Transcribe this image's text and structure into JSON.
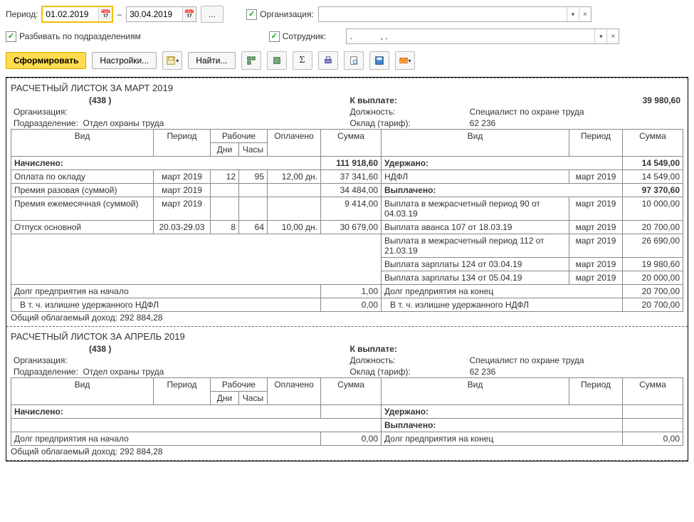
{
  "toolbar": {
    "period_label": "Период:",
    "date_from": "01.02.2019",
    "date_to": "30.04.2019",
    "dash": "–",
    "ellipsis": "...",
    "org_label": "Организация:",
    "split_label": "Разбивать по подразделениям",
    "emp_label": "Сотрудник:",
    "emp_value": ".            , .",
    "form_btn": "Сформировать",
    "settings_btn": "Настройки...",
    "find_btn": "Найти..."
  },
  "sheet1": {
    "title": "РАСЧЕТНЫЙ ЛИСТОК ЗА МАРТ 2019",
    "code": "(438       )",
    "org_label": "Организация:",
    "dept_label": "Подразделение:",
    "dept_value": "Отдел охраны труда",
    "pay_label": "К выплате:",
    "pay_value": "39 980,60",
    "pos_label": "Должность:",
    "pos_value": "Специалист по охране труда",
    "salary_label": "Оклад (тариф):",
    "salary_value": "62 236",
    "hdr": {
      "vid": "Вид",
      "period": "Период",
      "work": "Рабочие",
      "days": "Дни",
      "hours": "Часы",
      "paid": "Оплачено",
      "sum": "Сумма"
    },
    "accrued_label": "Начислено:",
    "accrued_total": "111 918,60",
    "withheld_label": "Удержано:",
    "withheld_total": "14 549,00",
    "paid_label": "Выплачено:",
    "paid_total": "97 370,60",
    "accruals": [
      {
        "name": "Оплата по окладу",
        "period": "март 2019",
        "days": "12",
        "hours": "95",
        "paid": "12,00 дн.",
        "sum": "37 341,60"
      },
      {
        "name": "Премия разовая (суммой)",
        "period": "март 2019",
        "days": "",
        "hours": "",
        "paid": "",
        "sum": "34 484,00"
      },
      {
        "name": "Премия ежемесячная (суммой)",
        "period": "март 2019",
        "days": "",
        "hours": "",
        "paid": "",
        "sum": "9 414,00"
      },
      {
        "name": "Отпуск основной",
        "period": "20.03-29.03",
        "days": "8",
        "hours": "64",
        "paid": "10,00 дн.",
        "sum": "30 679,00"
      }
    ],
    "withholdings": [
      {
        "name": "НДФЛ",
        "period": "март 2019",
        "sum": "14 549,00"
      }
    ],
    "payments": [
      {
        "name": "Выплата в межрасчетный период 90 от 04.03.19",
        "period": "март 2019",
        "sum": "10 000,00"
      },
      {
        "name": "Выплата аванса 107 от 18.03.19",
        "period": "март 2019",
        "sum": "20 700,00"
      },
      {
        "name": "Выплата в межрасчетный период 112 от 21.03.19",
        "period": "март 2019",
        "sum": "26 690,00"
      },
      {
        "name": "Выплата зарплаты 124 от 03.04.19",
        "period": "март 2019",
        "sum": "19 980,60"
      },
      {
        "name": "Выплата зарплаты 134 от 05.04.19",
        "period": "март 2019",
        "sum": "20 000,00"
      }
    ],
    "debt_start_label": "Долг предприятия на начало",
    "debt_start_val": "1,00",
    "debt_end_label": "Долг предприятия на конец",
    "debt_end_val": "20 700,00",
    "ndfl_excess_label": "В т. ч. излишне удержанного НДФЛ",
    "ndfl_excess_start": "0,00",
    "ndfl_excess_end": "20 700,00",
    "taxable_label": "Общий облагаемый доход:",
    "taxable_value": "292 884,28"
  },
  "sheet2": {
    "title": "РАСЧЕТНЫЙ ЛИСТОК ЗА АПРЕЛЬ 2019",
    "code": "(438       )",
    "org_label": "Организация:",
    "dept_label": "Подразделение:",
    "dept_value": "Отдел охраны труда",
    "pay_label": "К выплате:",
    "pos_label": "Должность:",
    "pos_value": "Специалист по охране труда",
    "salary_label": "Оклад (тариф):",
    "salary_value": "62 236",
    "accrued_label": "Начислено:",
    "withheld_label": "Удержано:",
    "paid_label": "Выплачено:",
    "debt_start_label": "Долг предприятия на начало",
    "debt_start_val": "0,00",
    "debt_end_label": "Долг предприятия на конец",
    "debt_end_val": "0,00",
    "taxable_label": "Общий облагаемый доход:",
    "taxable_value": "292 884,28"
  }
}
